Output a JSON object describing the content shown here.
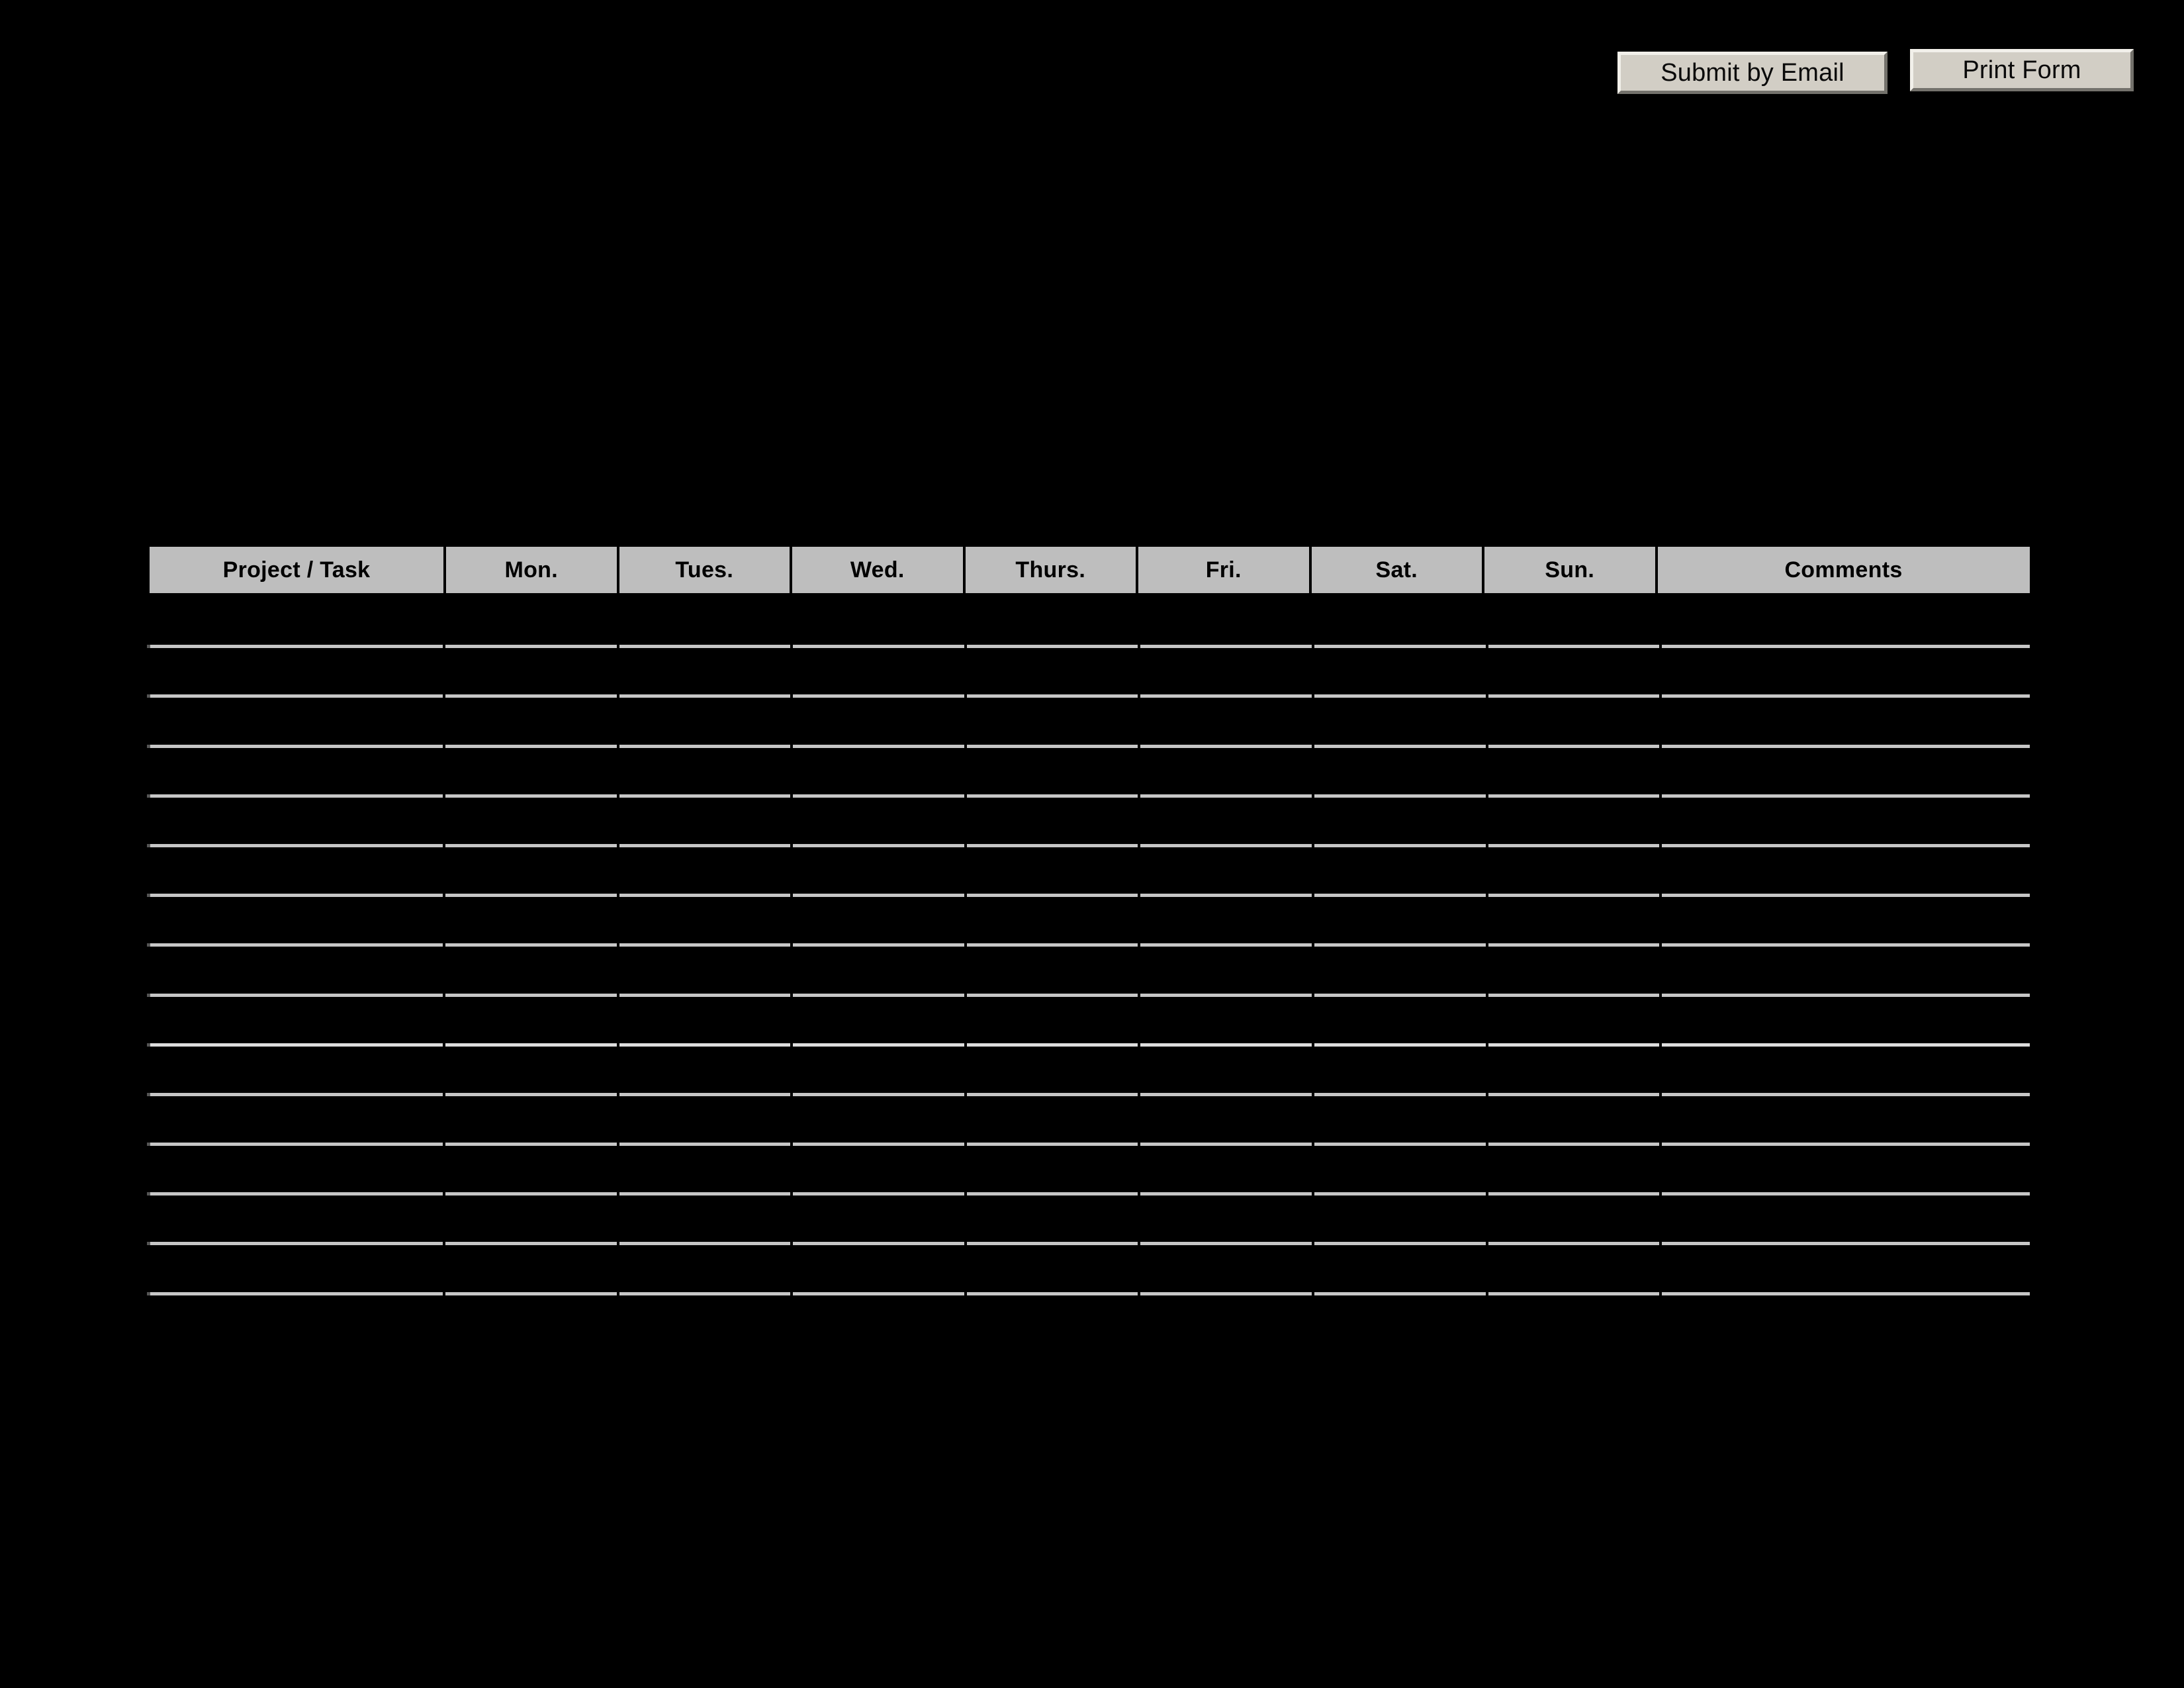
{
  "page": {
    "background_color": "#000000",
    "document_type": "weekly-timesheet-form"
  },
  "toolbar": {
    "submit_label": "Submit by Email",
    "print_label": "Print Form",
    "button_face_color": "#d2cec5"
  },
  "table": {
    "header_background": "#bebebe",
    "rule_color": "#c6c6c6",
    "bright_rule_color": "#dcdcdc",
    "bright_row_index": 8,
    "row_count": 14,
    "columns": [
      {
        "label": "Project / Task",
        "key": "task",
        "class": "col-task"
      },
      {
        "label": "Mon.",
        "key": "mon",
        "class": "col-day"
      },
      {
        "label": "Tues.",
        "key": "tues",
        "class": "col-day"
      },
      {
        "label": "Wed.",
        "key": "wed",
        "class": "col-day"
      },
      {
        "label": "Thurs.",
        "key": "thurs",
        "class": "col-day"
      },
      {
        "label": "Fri.",
        "key": "fri",
        "class": "col-day"
      },
      {
        "label": "Sat.",
        "key": "sat",
        "class": "col-day"
      },
      {
        "label": "Sun.",
        "key": "sun",
        "class": "col-day"
      },
      {
        "label": "Comments",
        "key": "comments",
        "class": "col-comments"
      }
    ],
    "rows": [
      {
        "task": "",
        "mon": "",
        "tues": "",
        "wed": "",
        "thurs": "",
        "fri": "",
        "sat": "",
        "sun": "",
        "comments": ""
      },
      {
        "task": "",
        "mon": "",
        "tues": "",
        "wed": "",
        "thurs": "",
        "fri": "",
        "sat": "",
        "sun": "",
        "comments": ""
      },
      {
        "task": "",
        "mon": "",
        "tues": "",
        "wed": "",
        "thurs": "",
        "fri": "",
        "sat": "",
        "sun": "",
        "comments": ""
      },
      {
        "task": "",
        "mon": "",
        "tues": "",
        "wed": "",
        "thurs": "",
        "fri": "",
        "sat": "",
        "sun": "",
        "comments": ""
      },
      {
        "task": "",
        "mon": "",
        "tues": "",
        "wed": "",
        "thurs": "",
        "fri": "",
        "sat": "",
        "sun": "",
        "comments": ""
      },
      {
        "task": "",
        "mon": "",
        "tues": "",
        "wed": "",
        "thurs": "",
        "fri": "",
        "sat": "",
        "sun": "",
        "comments": ""
      },
      {
        "task": "",
        "mon": "",
        "tues": "",
        "wed": "",
        "thurs": "",
        "fri": "",
        "sat": "",
        "sun": "",
        "comments": ""
      },
      {
        "task": "",
        "mon": "",
        "tues": "",
        "wed": "",
        "thurs": "",
        "fri": "",
        "sat": "",
        "sun": "",
        "comments": ""
      },
      {
        "task": "",
        "mon": "",
        "tues": "",
        "wed": "",
        "thurs": "",
        "fri": "",
        "sat": "",
        "sun": "",
        "comments": ""
      },
      {
        "task": "",
        "mon": "",
        "tues": "",
        "wed": "",
        "thurs": "",
        "fri": "",
        "sat": "",
        "sun": "",
        "comments": ""
      },
      {
        "task": "",
        "mon": "",
        "tues": "",
        "wed": "",
        "thurs": "",
        "fri": "",
        "sat": "",
        "sun": "",
        "comments": ""
      },
      {
        "task": "",
        "mon": "",
        "tues": "",
        "wed": "",
        "thurs": "",
        "fri": "",
        "sat": "",
        "sun": "",
        "comments": ""
      },
      {
        "task": "",
        "mon": "",
        "tues": "",
        "wed": "",
        "thurs": "",
        "fri": "",
        "sat": "",
        "sun": "",
        "comments": ""
      },
      {
        "task": "",
        "mon": "",
        "tues": "",
        "wed": "",
        "thurs": "",
        "fri": "",
        "sat": "",
        "sun": "",
        "comments": ""
      }
    ]
  }
}
